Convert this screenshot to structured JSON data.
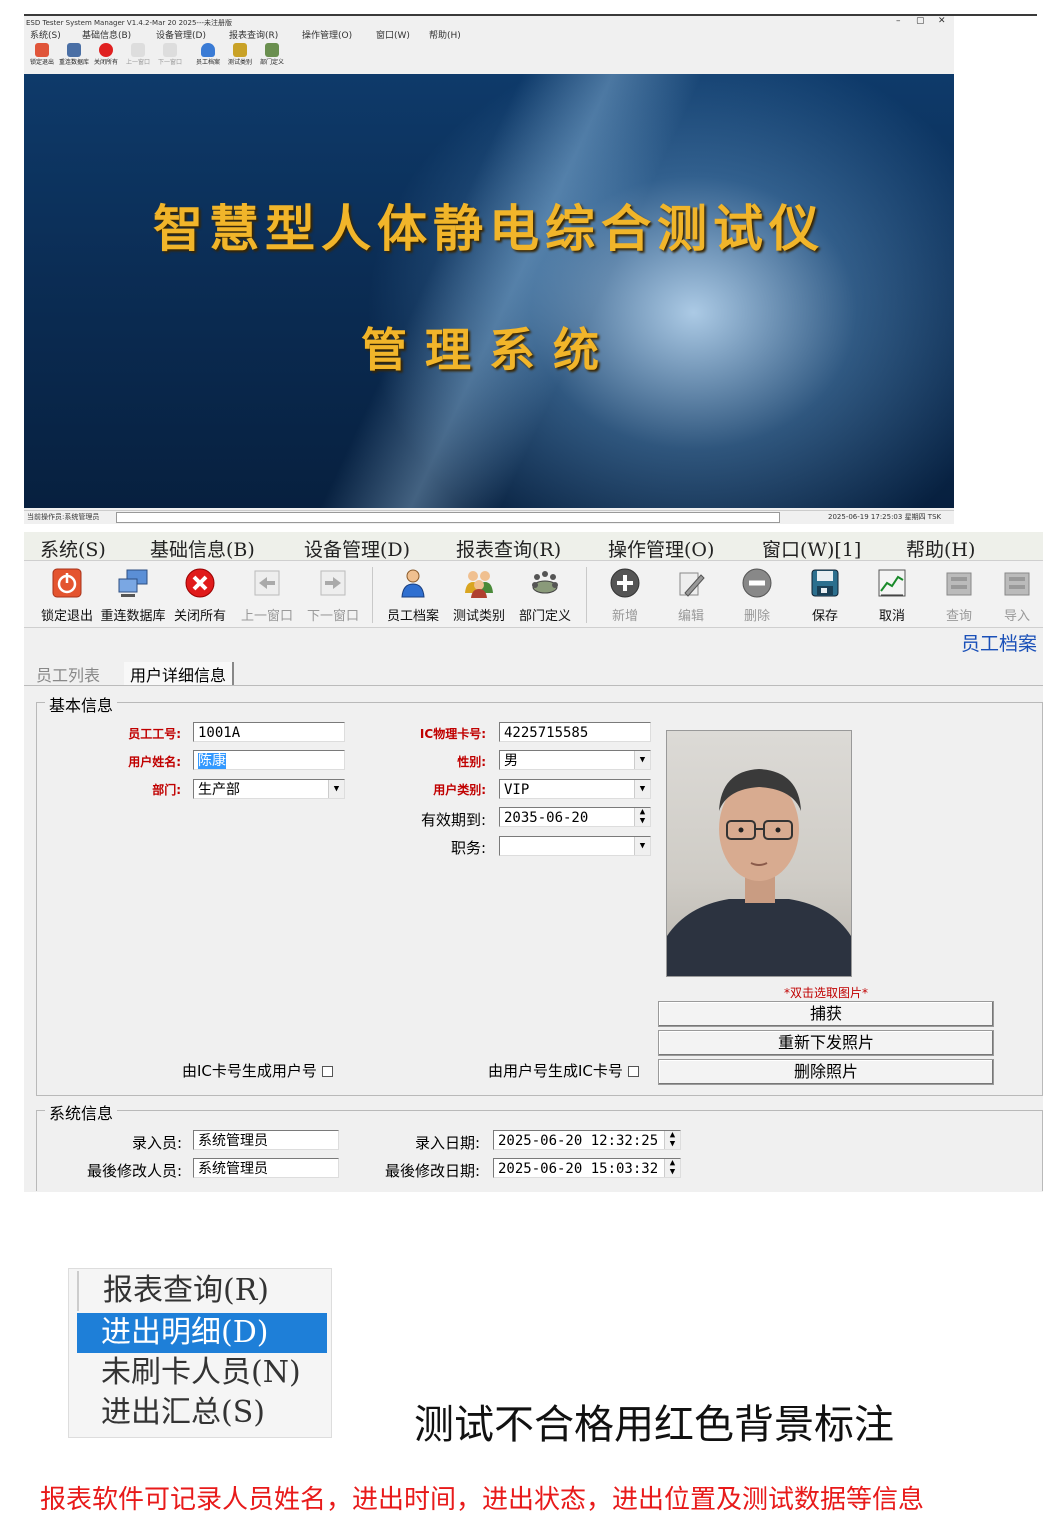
{
  "window_top": {
    "title": "ESD Tester System Manager V1.4.2-Mar 20 2025---未注册版",
    "controls": [
      "–",
      "▢",
      "✕"
    ],
    "menu": [
      "系统(S)",
      "基础信息(B)",
      "设备管理(D)",
      "报表查询(R)",
      "操作管理(O)",
      "窗口(W)",
      "帮助(H)"
    ],
    "toolbar": [
      "锁定退出",
      "重连数据库",
      "关闭所有",
      "上一窗口",
      "下一窗口",
      "员工档案",
      "测试类别",
      "部门定义"
    ],
    "splash_title": "智慧型人体静电综合测试仪",
    "splash_subtitle": "管理系统",
    "status_operator": "当前操作员:系统管理员",
    "status_time": "2025-06-19 17:25:03 星期四 TSK"
  },
  "window_main": {
    "menu": [
      "系统(S)",
      "基础信息(B)",
      "设备管理(D)",
      "报表查询(R)",
      "操作管理(O)",
      "窗口(W)[1]",
      "帮助(H)"
    ],
    "toolbar": {
      "lock_exit": "锁定退出",
      "reconnect": "重连数据库",
      "close_all": "关闭所有",
      "prev_window": "上一窗口",
      "next_window": "下一窗口",
      "employee": "员工档案",
      "test_type": "测试类别",
      "department": "部门定义",
      "add": "新增",
      "edit": "编辑",
      "delete": "删除",
      "save": "保存",
      "cancel": "取消",
      "query": "查询",
      "import": "导入"
    },
    "caption": "员工档案",
    "tabs": [
      "员工列表",
      "用户详细信息"
    ],
    "basic_group": "基本信息",
    "fields": {
      "emp_no_label": "员工工号:",
      "emp_no": "1001A",
      "name_label": "用户姓名:",
      "name": "陈康",
      "dept_label": "部门:",
      "dept": "生产部",
      "ic_label": "IC物理卡号:",
      "ic": "4225715585",
      "gender_label": "性别:",
      "gender": "男",
      "type_label": "用户类别:",
      "type": "VIP",
      "valid_label": "有效期到:",
      "valid": "2035-06-20",
      "duty_label": "职务:",
      "duty": ""
    },
    "photo_hint": "*双击选取图片*",
    "buttons": [
      "捕获",
      "重新下发照片",
      "删除照片"
    ],
    "check_ic_to_user": "由IC卡号生成用户号",
    "check_user_to_ic": "由用户号生成IC卡号",
    "sys_group": "系统信息",
    "sys": {
      "entry_user_label": "录入员:",
      "entry_user": "系统管理员",
      "modifier_label": "最後修改人员:",
      "modifier": "系统管理员",
      "entry_date_label": "录入日期:",
      "entry_date": "2025-06-20 12:32:25",
      "modify_date_label": "最後修改日期:",
      "modify_date": "2025-06-20 15:03:32"
    }
  },
  "report_menu": {
    "header": "报表查询(R)",
    "items": [
      "进出明细(D)",
      "未刷卡人员(N)",
      "进出汇总(S)"
    ],
    "highlighted_index": 0
  },
  "notes": {
    "red_background": "测试不合格用红色背景标注",
    "report_desc": "报表软件可记录人员姓名，进出时间，进出状态，进出位置及测试数据等信息"
  },
  "colors": {
    "splash_text": "#f1b52a",
    "caption_blue": "#1a50b8",
    "required_label_red": "#c00000",
    "menu_highlight": "#1e7fd8",
    "note_red": "#e81a1a"
  }
}
